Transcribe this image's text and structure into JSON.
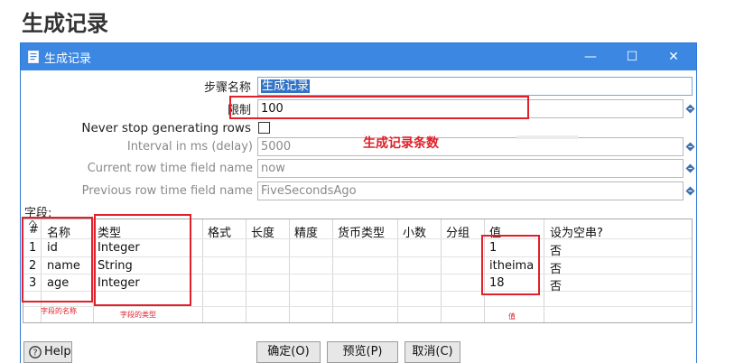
{
  "page_heading": "生成记录",
  "window": {
    "title": "生成记录",
    "controls": {
      "minimize": "—",
      "maximize": "☐",
      "close": "✕"
    }
  },
  "form": {
    "step_name": {
      "label": "步骤名称",
      "value": "生成记录"
    },
    "limit": {
      "label": "限制",
      "value": "100"
    },
    "never_stop": {
      "label": "Never stop generating rows",
      "checked": false
    },
    "interval": {
      "label": "Interval in ms (delay)",
      "value": "5000"
    },
    "current_time_field": {
      "label": "Current row time field name",
      "value": "now"
    },
    "previous_time_field": {
      "label": "Previous row time field name",
      "value": "FiveSecondsAgo"
    }
  },
  "fields_section_label": "字段:",
  "table": {
    "columns": [
      "#",
      "名称",
      "类型",
      "格式",
      "长度",
      "精度",
      "货币类型",
      "小数",
      "分组",
      "值",
      "设为空串?"
    ],
    "rows": [
      {
        "num": "1",
        "name": "id",
        "type": "Integer",
        "value": "1",
        "empty": "否"
      },
      {
        "num": "2",
        "name": "name",
        "type": "String",
        "value": "itheima",
        "empty": "否"
      },
      {
        "num": "3",
        "name": "age",
        "type": "Integer",
        "value": "18",
        "empty": "否"
      }
    ]
  },
  "annotations": {
    "limit_note": "生成记录条数",
    "name_note": "字段的名称",
    "type_note": "字段的类型",
    "value_note": "值"
  },
  "buttons": {
    "help": "Help",
    "ok": "确定(O)",
    "preview": "预览(P)",
    "cancel": "取消(C)"
  },
  "colors": {
    "titlebar": "#3c87e1",
    "annotation": "#e0202a",
    "selection": "#3373c4"
  }
}
